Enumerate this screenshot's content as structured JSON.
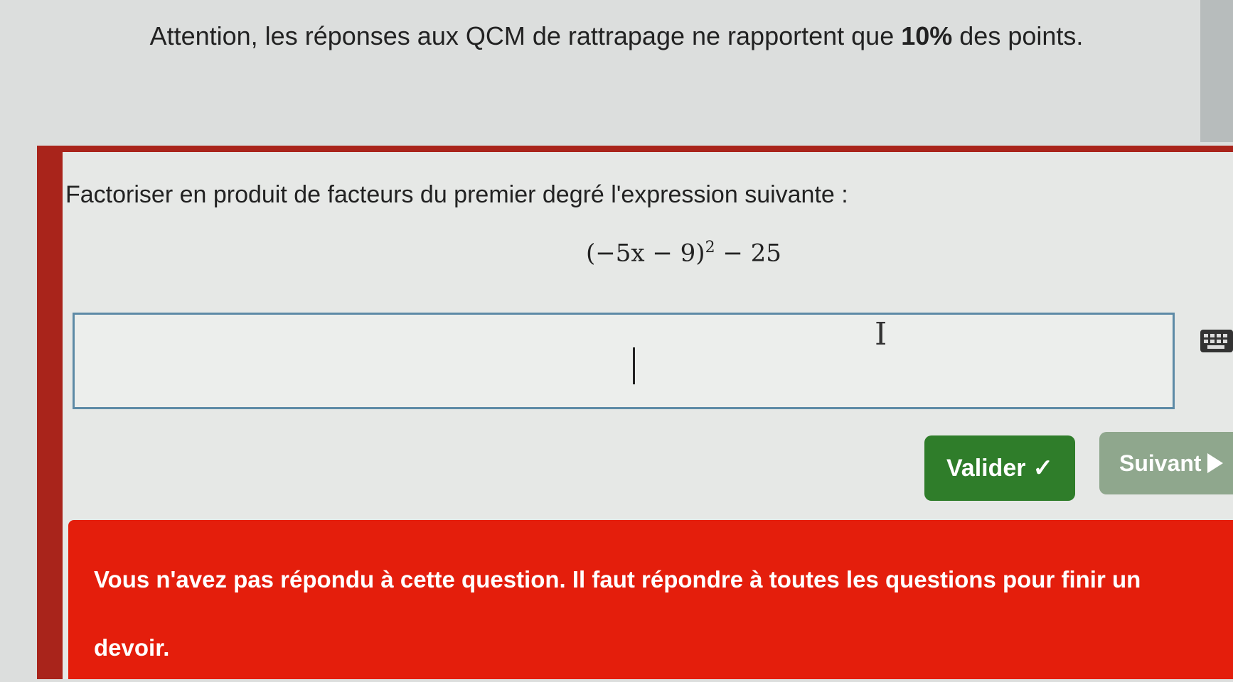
{
  "notice": {
    "text_before": "Attention, les réponses aux QCM de rattrapage ne rapportent que ",
    "text_bold": "10%",
    "text_after": " des points."
  },
  "question": {
    "prompt": "Factoriser en produit de facteurs du premier degré l'expression suivante :",
    "expression_base": "(−5x − 9)",
    "expression_exponent": "2",
    "expression_tail": " − 25"
  },
  "answer": {
    "value": ""
  },
  "buttons": {
    "valider_label": "Valider",
    "valider_icon": "✓",
    "suivant_label": "Suivant"
  },
  "error": {
    "message": "Vous n'avez pas répondu à cette question. Il faut répondre à toutes les questions pour finir un devoir."
  },
  "colors": {
    "card_border": "#a9241b",
    "valider_bg": "#2f7d2a",
    "suivant_bg": "#8fa78d",
    "error_bg": "#e41e0c",
    "answer_border": "#5d8aa6"
  }
}
